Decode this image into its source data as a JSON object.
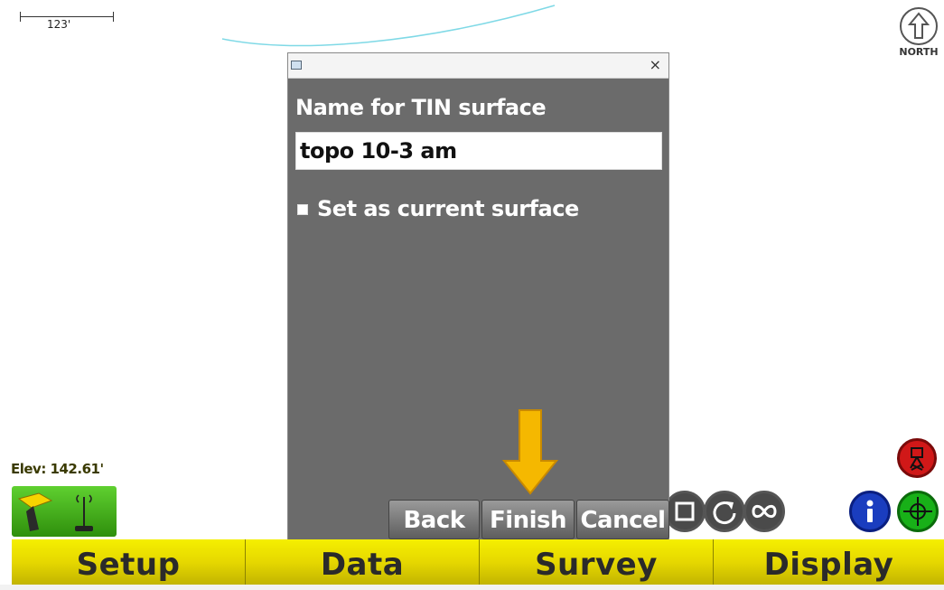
{
  "map": {
    "scale_label": "123'",
    "north_label": "NORTH",
    "elevation": "Elev: 142.61'"
  },
  "dialog": {
    "close_label": "×",
    "prompt": "Name for TIN surface",
    "name_value": "topo 10-3 am",
    "checkbox_label": "Set as current surface",
    "checkbox_checked": true,
    "buttons": {
      "back": "Back",
      "finish": "Finish",
      "cancel": "Cancel"
    }
  },
  "map_tools": [
    "square-icon",
    "refresh-icon",
    "infinity-icon",
    "info-icon",
    "crosshair-icon",
    "warning-icon"
  ],
  "menu": [
    {
      "label": "Setup"
    },
    {
      "label": "Data"
    },
    {
      "label": "Survey"
    },
    {
      "label": "Display"
    }
  ],
  "colors": {
    "menu_yellow": "#e6d800",
    "dialog_gray": "#6b6b6b",
    "highlight_arrow": "#f5b800",
    "status_green": "#4cbf20"
  }
}
